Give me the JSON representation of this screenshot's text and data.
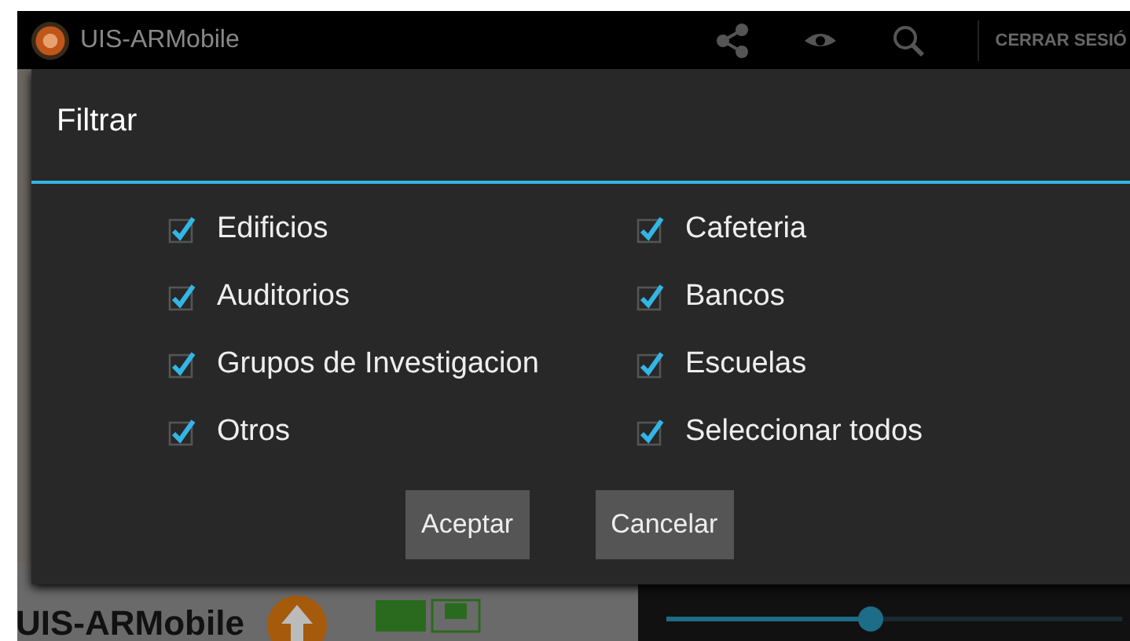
{
  "action_bar": {
    "title": "UIS-ARMobile",
    "logout": "CERRAR SESIÓ"
  },
  "background": {
    "title": "UIS-ARMobile"
  },
  "dialog": {
    "title": "Filtrar",
    "options": [
      {
        "label": "Edificios",
        "checked": true
      },
      {
        "label": "Cafeteria",
        "checked": true
      },
      {
        "label": "Auditorios",
        "checked": true
      },
      {
        "label": "Bancos",
        "checked": true
      },
      {
        "label": "Grupos de Investigacion",
        "checked": true
      },
      {
        "label": "Escuelas",
        "checked": true
      },
      {
        "label": "Otros",
        "checked": true
      },
      {
        "label": "Seleccionar todos",
        "checked": true
      }
    ],
    "buttons": [
      "Aceptar",
      "Cancelar"
    ]
  }
}
